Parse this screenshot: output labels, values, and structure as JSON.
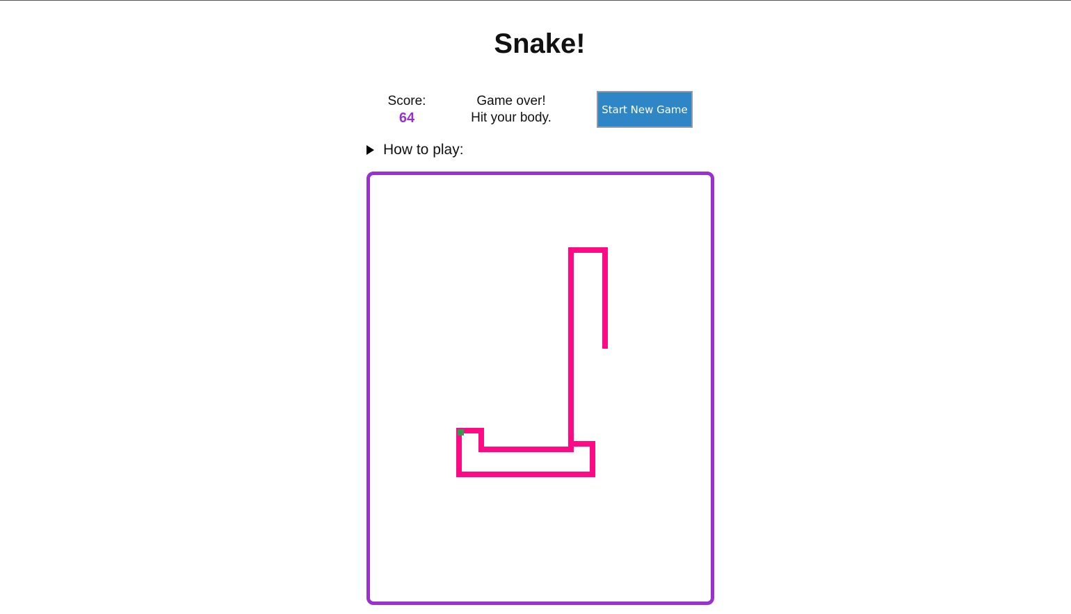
{
  "title": "Snake!",
  "score": {
    "label": "Score:",
    "value": "64"
  },
  "status": {
    "line1": "Game over!",
    "line2": "Hit your body."
  },
  "new_game_button": {
    "label": "Start New Game"
  },
  "how_to_play": {
    "label": "How to play:",
    "expanded": false
  },
  "colors": {
    "accent": "#9b30d0",
    "snake": "#ff0a84",
    "food": "#2e9a52",
    "button_bg": "#2f86c6"
  },
  "icons": {
    "disclosure": "triangle-right-icon"
  }
}
